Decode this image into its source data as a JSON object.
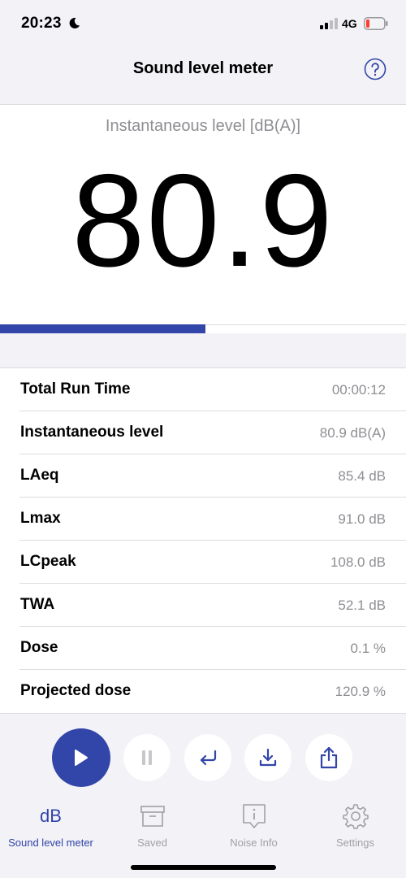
{
  "status": {
    "time": "20:23",
    "network": "4G",
    "icons": [
      "moon-icon",
      "signal-icon",
      "battery-low-icon"
    ],
    "battery_color": "#ff3b30"
  },
  "header": {
    "title": "Sound level meter",
    "help_icon": "question-circle-icon"
  },
  "meter": {
    "label": "Instantaneous level [dB(A)]",
    "value": "80.9",
    "level_fraction": 0.505,
    "accent": "#3245a8"
  },
  "stats": [
    {
      "label": "Total Run Time",
      "value": "00:00:12"
    },
    {
      "label": "Instantaneous level",
      "value": "80.9 dB(A)"
    },
    {
      "label": "LAeq",
      "value": "85.4 dB"
    },
    {
      "label": "Lmax",
      "value": "91.0 dB"
    },
    {
      "label": "LCpeak",
      "value": "108.0 dB"
    },
    {
      "label": "TWA",
      "value": "52.1 dB"
    },
    {
      "label": "Dose",
      "value": "0.1 %"
    },
    {
      "label": "Projected dose",
      "value": "120.9 %"
    }
  ],
  "controls": [
    "play-icon",
    "pause-icon",
    "return-icon",
    "download-icon",
    "share-icon"
  ],
  "tabs": [
    {
      "label": "Sound level meter",
      "glyph": "dB",
      "icon": "db-icon",
      "active": true
    },
    {
      "label": "Saved",
      "icon": "archive-box-icon",
      "active": false
    },
    {
      "label": "Noise Info",
      "icon": "info-bubble-icon",
      "active": false
    },
    {
      "label": "Settings",
      "icon": "gear-icon",
      "active": false
    }
  ]
}
